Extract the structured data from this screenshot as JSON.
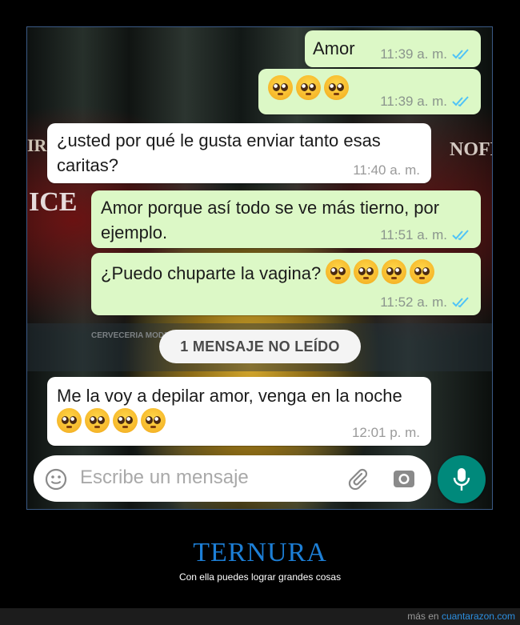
{
  "chat": {
    "messages": [
      {
        "direction": "out",
        "text": "Amor",
        "time": "11:39 a. m.",
        "read": true,
        "emoji_count": 0
      },
      {
        "direction": "out",
        "text": "",
        "time": "11:39 a. m.",
        "read": true,
        "emoji_count": 3
      },
      {
        "direction": "in",
        "text": "¿usted por qué le gusta enviar tanto esas caritas?",
        "time": "11:40 a. m.",
        "emoji_count": 0
      },
      {
        "direction": "out",
        "text": "Amor porque así todo se ve más tierno, por ejemplo.",
        "time": "11:51 a. m.",
        "read": true,
        "emoji_count": 0
      },
      {
        "direction": "out",
        "text": "¿Puedo chuparte la vagina?",
        "time": "11:52 a. m.",
        "read": true,
        "emoji_count": 4
      },
      {
        "direction": "in",
        "text": "Me la voy a depilar amor, venga en la noche",
        "time": "12:01 p. m.",
        "emoji_count": 4
      }
    ],
    "unread_label": "1 MENSAJE NO LEÍDO",
    "input_placeholder": "Escribe un mensaje",
    "emoji_name": "pleading-face",
    "colors": {
      "outgoing_bubble": "#dcf8c6",
      "incoming_bubble": "#ffffff",
      "read_ticks": "#4fc3f7",
      "mic_button": "#00897b"
    }
  },
  "background_labels": {
    "left_brand": "ICE",
    "left_top": "IR",
    "right_brand": "NOFF.",
    "brewery": "CERVECERIA MODELO"
  },
  "caption": {
    "title": "TERNURA",
    "subtitle": "Con ella puedes lograr grandes cosas"
  },
  "footer": {
    "prefix": "más en",
    "site": "cuantarazon.com"
  }
}
